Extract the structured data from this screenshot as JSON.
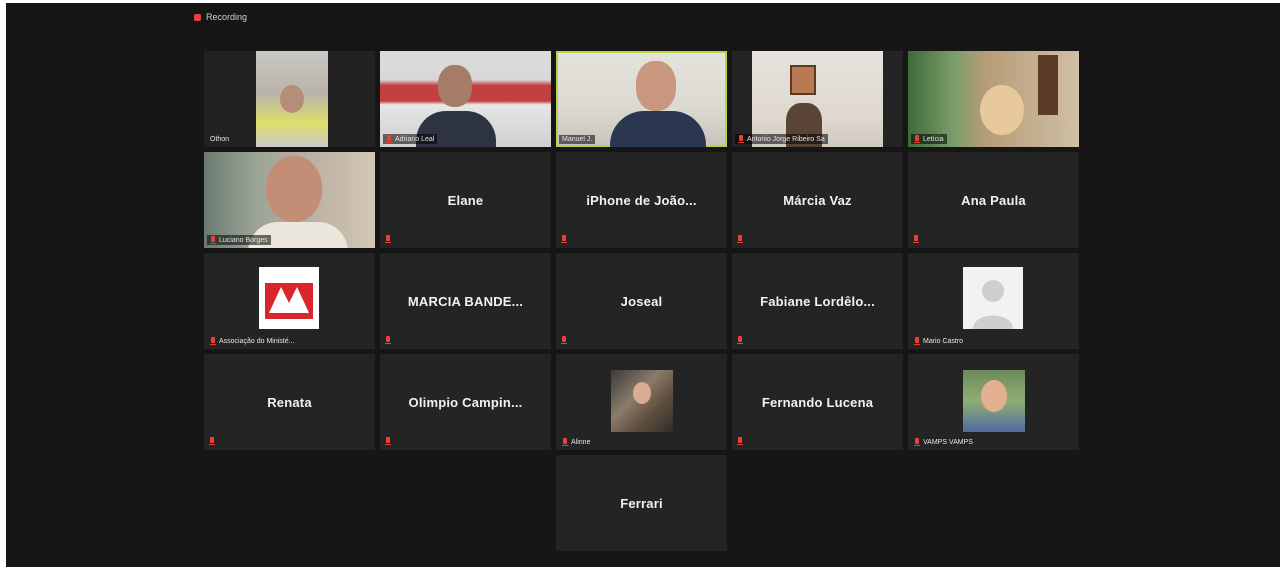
{
  "recording": {
    "label": "Recording",
    "color": "#e8413b"
  },
  "colors": {
    "background": "#161616",
    "tile": "#242424",
    "active_border": "#b7d34a",
    "muted": "#e8413b"
  },
  "participants": [
    {
      "id": "p1",
      "label": "Othon",
      "video": true
    },
    {
      "id": "p2",
      "label": "Adriano Leal",
      "video": true
    },
    {
      "id": "p3",
      "label": "Manuel J.",
      "video": true,
      "speaking": true
    },
    {
      "id": "p4",
      "label": "Antonio Jorge Ribeiro Sa",
      "video": true
    },
    {
      "id": "p5",
      "label": "Letícia",
      "video": true
    },
    {
      "id": "p6",
      "label": "Luciano Borges",
      "video": true
    },
    {
      "id": "p7",
      "name": "Elane"
    },
    {
      "id": "p8",
      "name": "iPhone de João..."
    },
    {
      "id": "p9",
      "name": "Márcia Vaz"
    },
    {
      "id": "p10",
      "name": "Ana Paula"
    },
    {
      "id": "p11",
      "label": "Associação do Ministé...",
      "avatar": "logo"
    },
    {
      "id": "p12",
      "name": "MARCIA BANDE..."
    },
    {
      "id": "p13",
      "name": "Joseal"
    },
    {
      "id": "p14",
      "name": "Fabiane Lordêlo..."
    },
    {
      "id": "p15",
      "label": "Mario Castro",
      "avatar": "silhouette"
    },
    {
      "id": "p16",
      "name": "Renata"
    },
    {
      "id": "p17",
      "name": "Olimpio Campin..."
    },
    {
      "id": "p18",
      "label": "Alinne",
      "avatar": "photo"
    },
    {
      "id": "p19",
      "name": "Fernando Lucena"
    },
    {
      "id": "p20",
      "label": "VAMPS VAMPS",
      "avatar": "photo"
    },
    {
      "id": "p21",
      "name": "Ferrari"
    }
  ]
}
